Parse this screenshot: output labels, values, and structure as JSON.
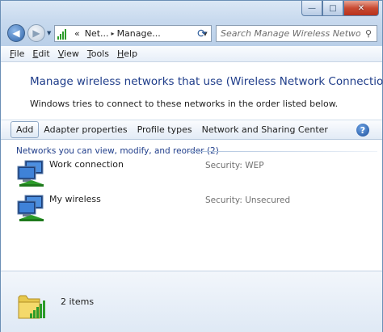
{
  "window": {
    "caption_buttons": {
      "minimize": "—",
      "maximize": "□",
      "close": "✕"
    }
  },
  "address": {
    "overflow": "«",
    "segments": [
      "Net...",
      "Manage..."
    ],
    "separator": "▸"
  },
  "search": {
    "placeholder": "Search Manage Wireless Networks"
  },
  "menu": {
    "items": [
      {
        "key": "F",
        "rest": "ile"
      },
      {
        "key": "E",
        "rest": "dit"
      },
      {
        "key": "V",
        "rest": "iew"
      },
      {
        "key": "T",
        "rest": "ools"
      },
      {
        "key": "H",
        "rest": "elp"
      }
    ]
  },
  "header": {
    "title": "Manage wireless networks that use (Wireless Network Connection)",
    "subtitle": "Windows tries to connect to these networks in the order listed below."
  },
  "toolbar": {
    "add": "Add",
    "adapter_properties": "Adapter properties",
    "profile_types": "Profile types",
    "network_sharing": "Network and Sharing Center"
  },
  "group": {
    "header": "Networks you can view, modify, and reorder (2)"
  },
  "networks": [
    {
      "name": "Work connection",
      "security": "Security:  WEP"
    },
    {
      "name": "My wireless",
      "security": "Security:  Unsecured"
    }
  ],
  "status": {
    "count": "2 items"
  },
  "colors": {
    "title": "#1f3d8a",
    "accent": "#2e63a8",
    "signal": "#2d9c2a"
  },
  "icons": [
    "back-arrow-icon",
    "forward-arrow-icon",
    "signal-bars-icon",
    "refresh-icon",
    "search-icon",
    "help-icon",
    "wireless-network-icon",
    "folder-network-icon"
  ]
}
